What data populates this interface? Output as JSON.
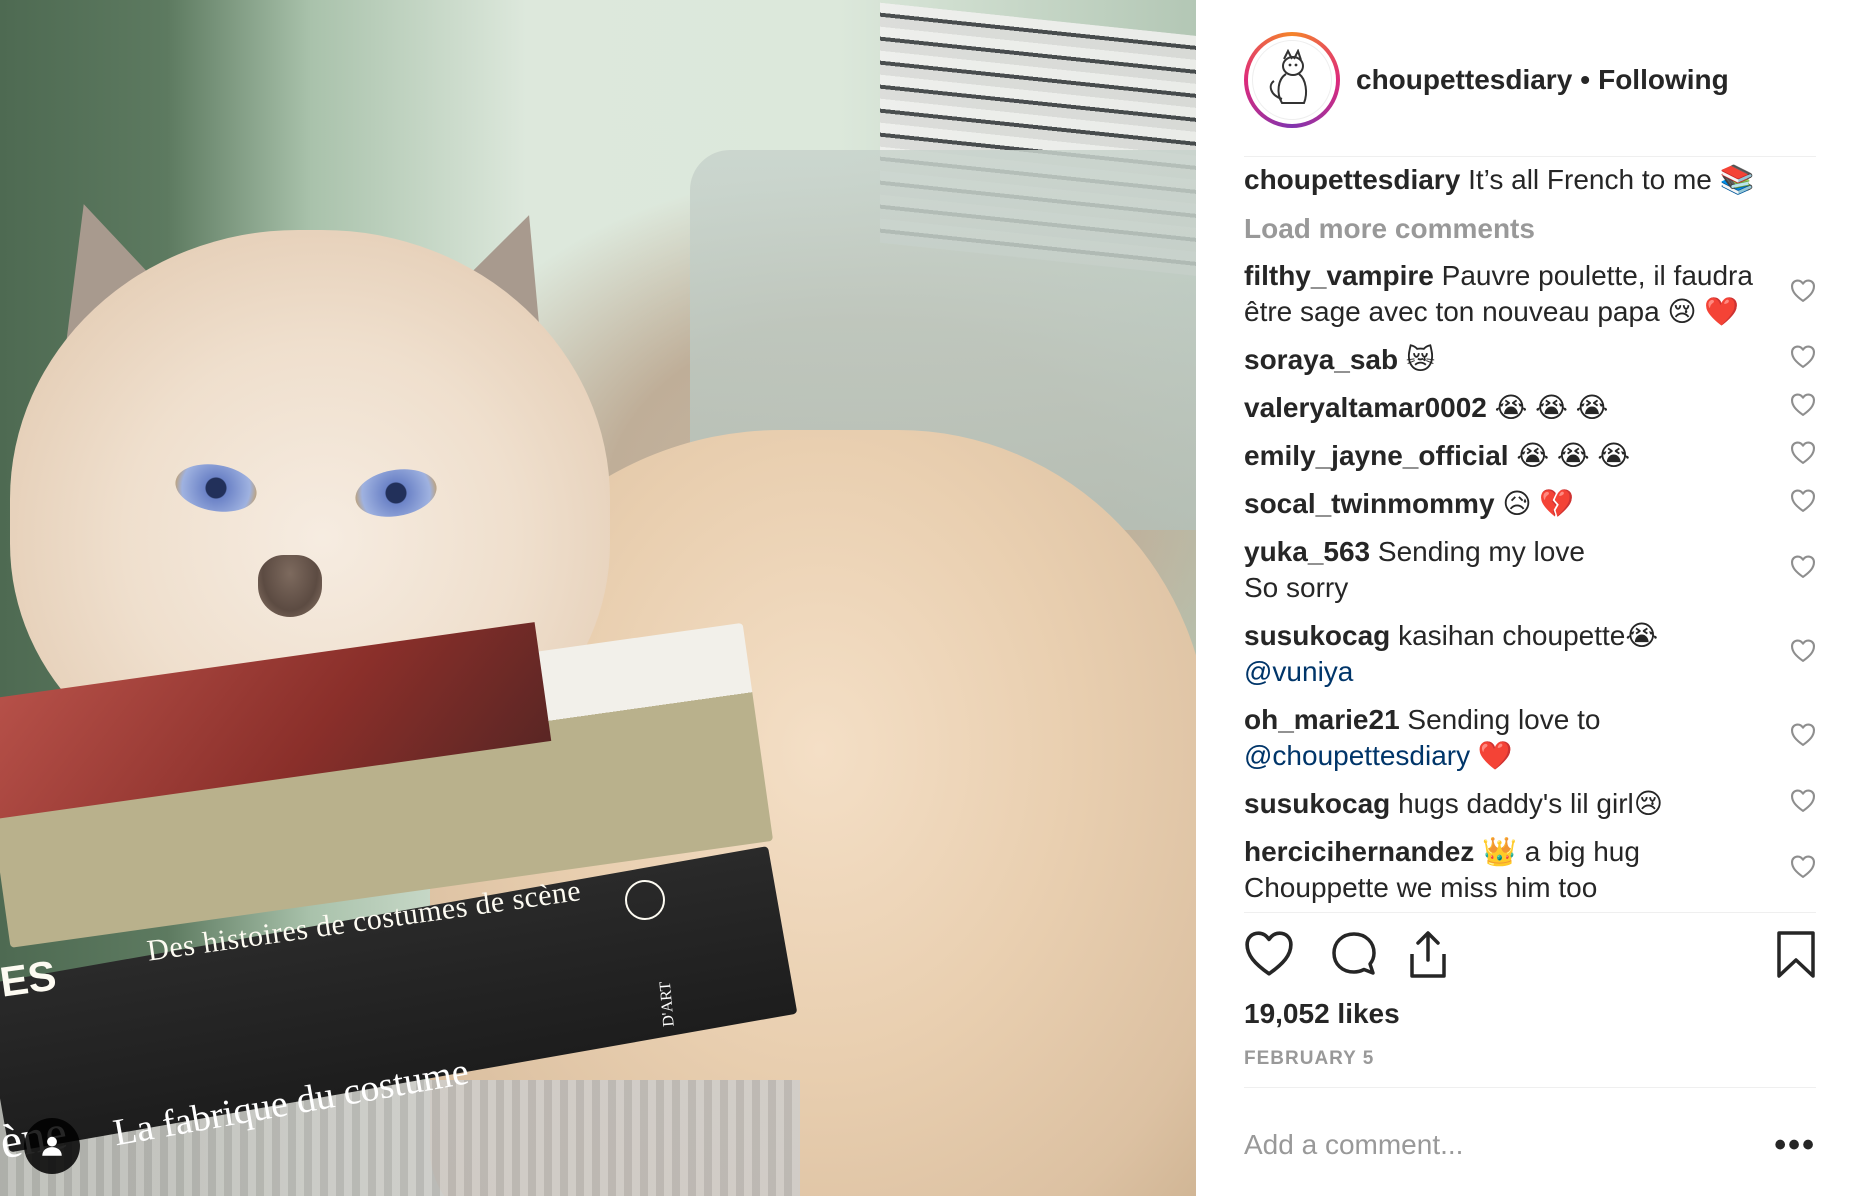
{
  "photo": {
    "book_title_1_left": "ES",
    "book_title_1": "Des histoires de costumes de scène",
    "book_title_2_left": "ène",
    "book_title_2": "La fabrique du costume",
    "book_mark": "D'ART"
  },
  "header": {
    "username": "choupettesdiary",
    "separator": "•",
    "follow_status": "Following"
  },
  "caption": {
    "username": "choupettesdiary",
    "text": "It’s all French to me 📚"
  },
  "load_more": "Load more comments",
  "comments": [
    {
      "user": "filthy_vampire",
      "text": "Pauvre poulette, il faudra être sage avec ton nouveau papa 😢 ❤️",
      "mention": ""
    },
    {
      "user": "soraya_sab",
      "text": "😿",
      "mention": ""
    },
    {
      "user": "valeryaltamar0002",
      "text": "😭 😭 😭",
      "mention": ""
    },
    {
      "user": "emily_jayne_official",
      "text": "😭 😭 😭",
      "mention": ""
    },
    {
      "user": "socal_twinmommy",
      "text": "😥 💔",
      "mention": ""
    },
    {
      "user": "yuka_563",
      "text": "Sending my love\nSo sorry",
      "mention": ""
    },
    {
      "user": "susukocag",
      "text": "kasihan choupette😭",
      "mention": "@vuniya"
    },
    {
      "user": "oh_marie21",
      "text": "Sending love to",
      "mention": "@choupettesdiary",
      "suffix": "❤️"
    },
    {
      "user": "susukocag",
      "text": "hugs daddy's lil girl😢",
      "mention": ""
    },
    {
      "user": "hercicihernandez",
      "text": "👑  a big hug Chouppette we miss him too",
      "mention": ""
    }
  ],
  "likes": "19,052 likes",
  "date": "FEBRUARY 5",
  "add_comment": {
    "placeholder": "Add a comment..."
  },
  "more_options": "•••",
  "icons": {
    "like": "heart-icon",
    "comment": "comment-bubble-icon",
    "share": "share-icon",
    "save": "bookmark-icon",
    "tag": "user-tag-icon"
  }
}
